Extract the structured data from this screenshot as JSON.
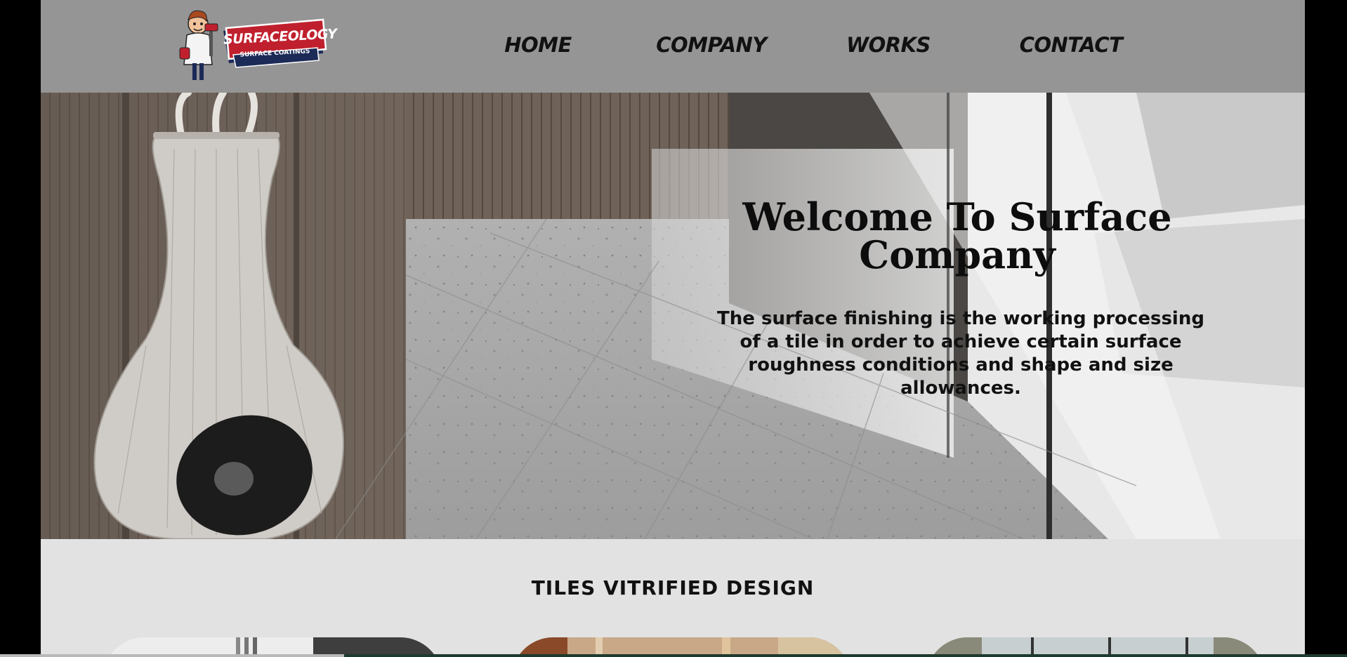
{
  "brand": {
    "logo_word": "SURFACEOLOGY",
    "logo_tagline": "SURFACE COATINGS",
    "colors": {
      "logo_red": "#c0202e",
      "logo_navy": "#1c2a57"
    }
  },
  "nav": {
    "items": [
      {
        "label": "HOME"
      },
      {
        "label": "COMPANY"
      },
      {
        "label": "WORKS"
      },
      {
        "label": "CONTACT"
      }
    ]
  },
  "hero": {
    "title": "Welcome To Surface Company",
    "text": "The surface finishing is the working processing of a tile in order to achieve certain surface roughness conditions and shape and size allowances."
  },
  "section": {
    "heading": "TILES VITRIFIED DESIGN",
    "cards": [
      {
        "name": "tile-card-1"
      },
      {
        "name": "tile-card-2"
      },
      {
        "name": "tile-card-3"
      }
    ]
  },
  "colors": {
    "header_bg": "#959595",
    "page_bg": "#000000",
    "section_bg": "#e2e2e2",
    "text": "#111111"
  }
}
